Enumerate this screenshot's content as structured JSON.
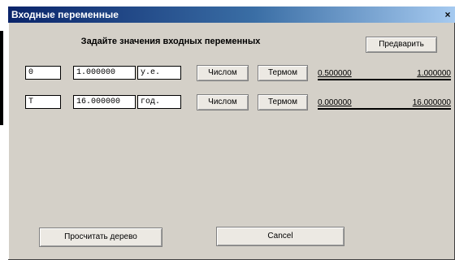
{
  "window": {
    "title": "Входные переменные",
    "close_label": "×"
  },
  "instruction": "Задайте значения входных переменных",
  "buttons": {
    "preview": "Предварить",
    "calculate_tree": "Просчитать дерево",
    "cancel": "Cancel"
  },
  "rows": [
    {
      "name": "0",
      "value": "1.000000",
      "unit": "у.е.",
      "numeric_btn": "Числом",
      "term_btn": "Термом",
      "range_min": "0.500000",
      "range_max": "1.000000"
    },
    {
      "name": "T",
      "value": "16.000000",
      "unit": "год.",
      "numeric_btn": "Числом",
      "term_btn": "Термом",
      "range_min": "0.000000",
      "range_max": "16.000000"
    }
  ]
}
